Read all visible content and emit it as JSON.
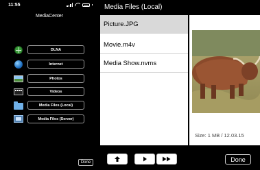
{
  "phone": {
    "status_time": "11:55",
    "app_title": "MediaCenter",
    "menu": [
      {
        "label": "DLNA",
        "icon": "dlna-icon"
      },
      {
        "label": "Internet",
        "icon": "globe-icon"
      },
      {
        "label": "Photos",
        "icon": "photos-icon"
      },
      {
        "label": "Videos",
        "icon": "videos-icon"
      },
      {
        "label": "Media Files (Local)",
        "icon": "folder-icon"
      },
      {
        "label": "Media Files (Server)",
        "icon": "server-icon"
      }
    ],
    "done_label": "Done"
  },
  "tablet": {
    "title": "Media Files (Local)",
    "files": [
      {
        "name": "Picture.JPG",
        "selected": true
      },
      {
        "name": "Movie.m4v",
        "selected": false
      },
      {
        "name": "Media Show.nvms",
        "selected": false
      }
    ],
    "preview_caption": "Size: 1 MB / 12.03.15",
    "preview_icon": "highland-cow-photo",
    "toolbar": {
      "up_icon": "up-arrow-icon",
      "play_icon": "play-icon",
      "fast_forward_icon": "fast-forward-icon",
      "done_label": "Done"
    }
  },
  "colors": {
    "background": "#000000",
    "list_background": "#ffffff",
    "selected_row": "#d9d9d9",
    "button_border": "#9a9a9a"
  }
}
